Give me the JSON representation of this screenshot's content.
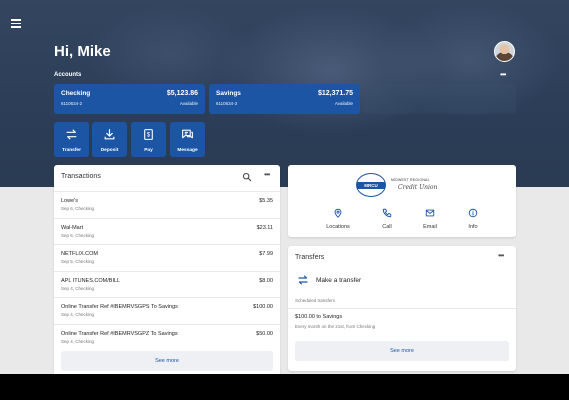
{
  "header": {
    "greeting": "Hi, Mike",
    "accounts_label": "Accounts",
    "more_glyph": "•••"
  },
  "accounts": [
    {
      "name": "Checking",
      "number": "6110634-2",
      "balance": "$5,123.86",
      "balance_label": "Available"
    },
    {
      "name": "Savings",
      "number": "6110634-3",
      "balance": "$12,371.75",
      "balance_label": "Available"
    }
  ],
  "actions": [
    {
      "label": "Transfer",
      "icon": "transfer-icon"
    },
    {
      "label": "Deposit",
      "icon": "deposit-icon"
    },
    {
      "label": "Pay",
      "icon": "pay-icon"
    },
    {
      "label": "Message",
      "icon": "message-icon"
    }
  ],
  "transactions": {
    "title": "Transactions",
    "items": [
      {
        "desc": "Lowe's",
        "sub": "Sep 6, Checking",
        "amount": "$5.35"
      },
      {
        "desc": "Wal-Mart",
        "sub": "Sep 6, Checking",
        "amount": "$23.11"
      },
      {
        "desc": "NETFLIX.COM",
        "sub": "Sep 5, Checking",
        "amount": "$7.99"
      },
      {
        "desc": "APL ITUNES.COM/BILL",
        "sub": "Sep 4, Checking",
        "amount": "$8.00"
      },
      {
        "desc": "Online Transfer Ref #IBEMRVSGPS To Savings",
        "sub": "Sep 4, Checking",
        "amount": "$100.00"
      },
      {
        "desc": "Online Transfer Ref #IBEMRVSGPZ To Savings",
        "sub": "Sep 4, Checking",
        "amount": "$50.00"
      }
    ],
    "see_more": "See more"
  },
  "credit_union": {
    "seal_text": "MRCU",
    "name": "MIDWEST REGIONAL",
    "script": "Credit Union",
    "actions": [
      {
        "label": "Locations",
        "icon": "location-pin-icon"
      },
      {
        "label": "Call",
        "icon": "phone-icon"
      },
      {
        "label": "Email",
        "icon": "email-icon"
      },
      {
        "label": "Info",
        "icon": "info-icon"
      }
    ]
  },
  "transfers": {
    "title": "Transfers",
    "make_label": "Make a transfer",
    "scheduled_label": "Scheduled transfers",
    "scheduled_item": "$100.00 to Savings",
    "scheduled_sub": "Every month on the 21st, from Checking",
    "see_more": "See more"
  },
  "colors": {
    "brand_blue": "#1d55a5",
    "hero_dark": "#2c3e58",
    "page_bg": "#e9e9e9"
  }
}
